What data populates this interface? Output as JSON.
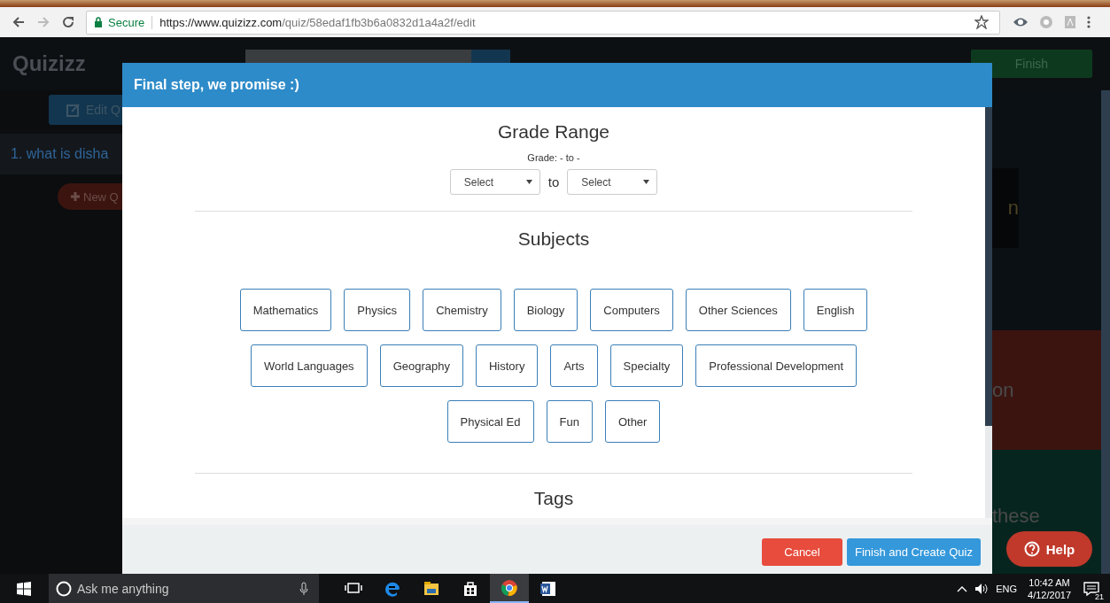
{
  "browser": {
    "secure_label": "Secure",
    "url_host": "https://www.quizizz.com",
    "url_path": "/quiz/58edaf1fb3b6a0832d1a4a2f/edit"
  },
  "app": {
    "logo": "Quizizz",
    "finish_button": "Finish",
    "edit_button": "Edit Q",
    "question": "1. what is disha",
    "new_button": "New Q",
    "right_texts": [
      "n",
      "on",
      "these"
    ]
  },
  "modal": {
    "title": "Final step, we promise :)",
    "grade_title": "Grade Range",
    "grade_summary": "Grade: - to -",
    "grade_from": "Select",
    "grade_to_label": "to",
    "grade_to": "Select",
    "subjects_title": "Subjects",
    "subjects": [
      {
        "label": "Mathematics",
        "selected": false
      },
      {
        "label": "Physics",
        "selected": false
      },
      {
        "label": "Chemistry",
        "selected": false
      },
      {
        "label": "Biology",
        "selected": false
      },
      {
        "label": "Computers",
        "selected": false
      },
      {
        "label": "Other Sciences",
        "selected": false
      },
      {
        "label": "English",
        "selected": false
      },
      {
        "label": "World Languages",
        "selected": false
      },
      {
        "label": "Geography",
        "selected": false
      },
      {
        "label": "History",
        "selected": false
      },
      {
        "label": "Arts",
        "selected": false
      },
      {
        "label": "Specialty",
        "selected": false
      },
      {
        "label": "Professional Development",
        "selected": false
      },
      {
        "label": "Physical Ed",
        "selected": false
      },
      {
        "label": "Fun",
        "selected": false
      },
      {
        "label": "Other",
        "selected": false
      }
    ],
    "tags_title": "Tags",
    "buttons": [
      {
        "kind": "cancel",
        "label": "Cancel"
      },
      {
        "kind": "primary",
        "label": "Finish and Create Quiz"
      }
    ]
  },
  "help_button": "Help",
  "taskbar": {
    "search_placeholder": "Ask me anything",
    "apps": [
      {
        "kind": "taskview",
        "selected": false
      },
      {
        "kind": "edge",
        "selected": false
      },
      {
        "kind": "explorer",
        "selected": false
      },
      {
        "kind": "store",
        "selected": false
      },
      {
        "kind": "chrome",
        "selected": true
      },
      {
        "kind": "word",
        "selected": false
      }
    ],
    "language": "ENG",
    "time": "10:42 AM",
    "date": "4/12/2017",
    "notifications": "21"
  }
}
